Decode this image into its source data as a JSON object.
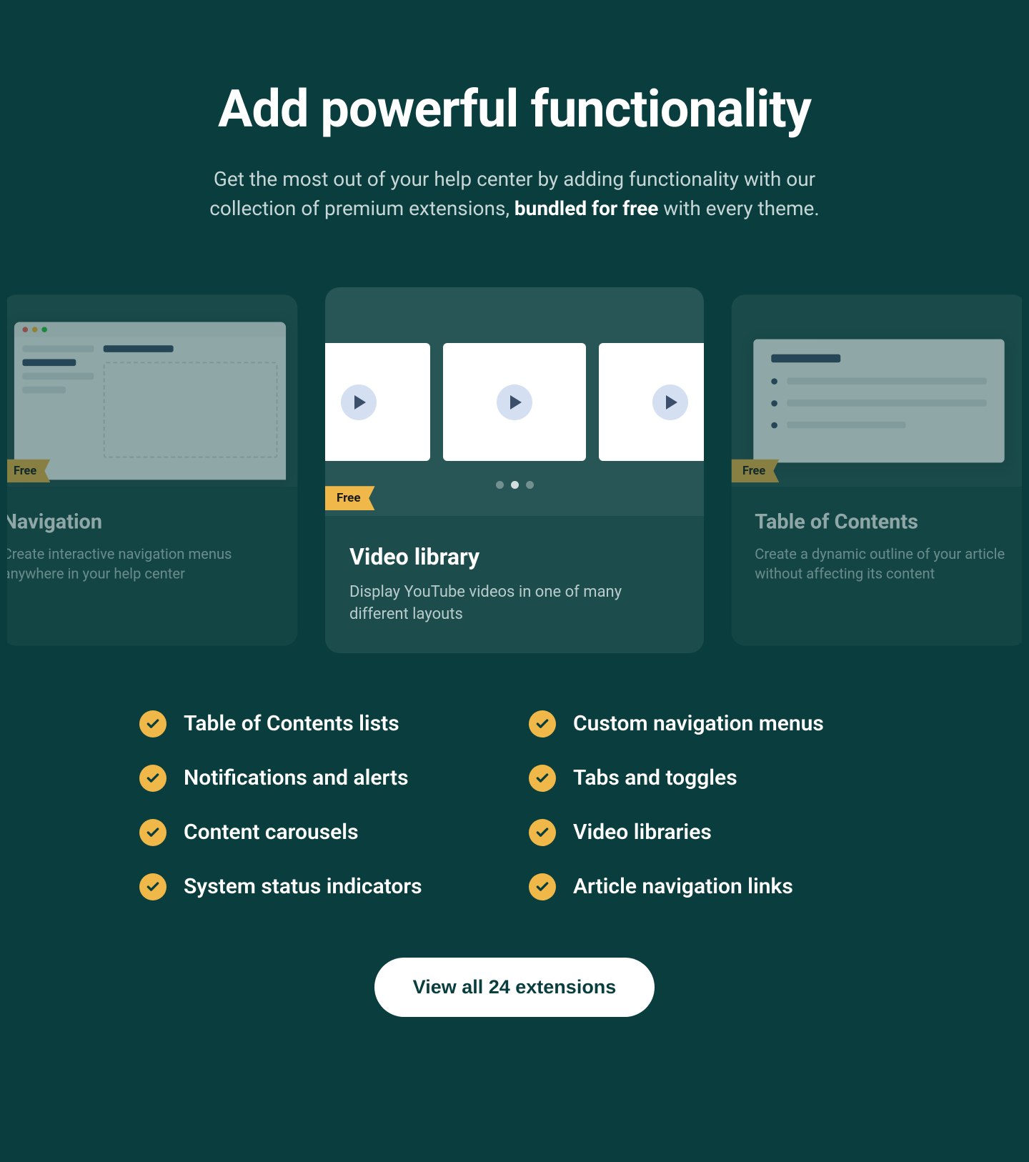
{
  "hero": {
    "title": "Add powerful functionality",
    "subtitle_pre": "Get the most out of your help center by adding functionality with our collection of premium extensions, ",
    "subtitle_strong": "bundled for free",
    "subtitle_post": " with every theme."
  },
  "cards": [
    {
      "badge": "Free",
      "title": "Navigation",
      "description": "Create interactive navigation menus anywhere in your help center"
    },
    {
      "badge": "Free",
      "title": "Video library",
      "description": "Display YouTube videos in one of many different layouts"
    },
    {
      "badge": "Free",
      "title": "Table of Contents",
      "description": "Create a dynamic outline of your article without affecting its content"
    }
  ],
  "features": [
    "Table of Contents lists",
    "Custom navigation menus",
    "Notifications and alerts",
    "Tabs and toggles",
    "Content carousels",
    "Video libraries",
    "System status indicators",
    "Article navigation links"
  ],
  "cta": {
    "label": "View all 24 extensions",
    "count": 24
  }
}
